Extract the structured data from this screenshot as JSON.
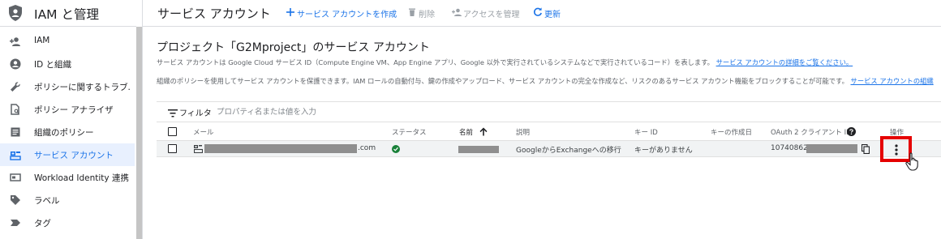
{
  "sidebar": {
    "title": "IAM と管理",
    "items": [
      {
        "label": "IAM",
        "icon": "person-add-icon",
        "active": false
      },
      {
        "label": "ID と組織",
        "icon": "account-circle-icon",
        "active": false
      },
      {
        "label": "ポリシーに関するトラブ...",
        "icon": "wrench-icon",
        "active": false
      },
      {
        "label": "ポリシー アナライザ",
        "icon": "document-search-icon",
        "active": false
      },
      {
        "label": "組織のポリシー",
        "icon": "article-icon",
        "active": false
      },
      {
        "label": "サービス アカウント",
        "icon": "service-account-icon",
        "active": true
      },
      {
        "label": "Workload Identity 連携",
        "icon": "id-card-icon",
        "active": false
      },
      {
        "label": "ラベル",
        "icon": "label-icon",
        "active": false
      },
      {
        "label": "タグ",
        "icon": "tag-icon",
        "active": false
      }
    ]
  },
  "topbar": {
    "title": "サービス アカウント",
    "create_label": "サービス アカウントを作成",
    "delete_label": "削除",
    "manage_access_label": "アクセスを管理",
    "refresh_label": "更新"
  },
  "main": {
    "heading": "プロジェクト「G2Mproject」のサービス アカウント",
    "desc1_text": "サービス アカウントは Google Cloud サービス ID（Compute Engine VM、App Engine アプリ、Google 以外で実行されているシステムなどで実行されているコード）を表します。",
    "desc1_link": "サービス アカウントの詳細をご覧ください。",
    "desc2_text": "組織のポリシーを使用してサービス アカウントを保護できます。IAM ロールの自動付与、鍵の作成やアップロード、サービス アカウントの完全な作成など、リスクのあるサービス アカウント機能をブロックすることが可能です。",
    "desc2_link": "サービス アカウントの組織"
  },
  "filter": {
    "label": "フィルタ",
    "placeholder": "プロパティ名または値を入力"
  },
  "table": {
    "headers": {
      "email": "メール",
      "status": "ステータス",
      "name": "名前",
      "description": "説明",
      "key_id": "キー ID",
      "key_created": "キーの作成日",
      "oauth_client_id": "OAuth 2 クライアント ID",
      "actions": "操作"
    },
    "rows": [
      {
        "email_suffix": ".com",
        "description": "GoogleからExchangeへの移行",
        "key_id": "キーがありません",
        "oauth_prefix": "107408621"
      }
    ]
  },
  "colors": {
    "accent": "#1a73e8",
    "status_ok": "#188038",
    "highlight": "#e50000"
  }
}
